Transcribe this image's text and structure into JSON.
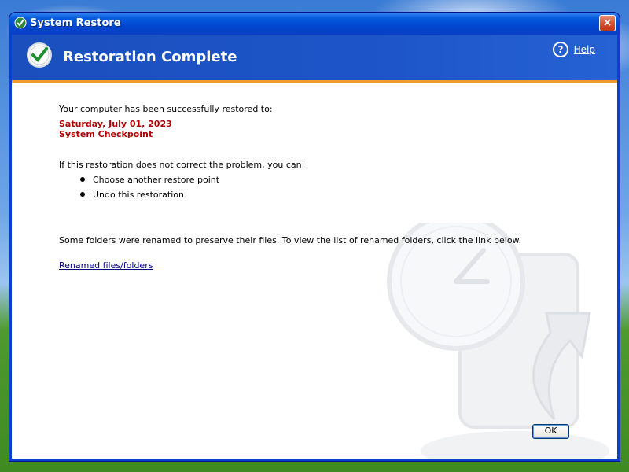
{
  "window": {
    "title": "System Restore",
    "close_label": "×"
  },
  "header": {
    "title": "Restoration Complete",
    "help_mark": "?",
    "help_label": "Help"
  },
  "content": {
    "restored_to_text": "Your computer has been successfully restored to:",
    "restore_date": "Saturday, July 01, 2023",
    "restore_point_name": "System Checkpoint",
    "options_intro": "If this restoration does not correct the problem, you can:",
    "options": [
      "Choose another restore point",
      "Undo this restoration"
    ],
    "renamed_note": "Some folders were renamed to preserve their files. To view the list of renamed folders, click the link below.",
    "renamed_link": "Renamed files/folders"
  },
  "buttons": {
    "ok_label": "OK"
  },
  "colors": {
    "header_blue": "#1d55c8",
    "accent_orange": "#ee9a2f",
    "date_red": "#b00000",
    "link_blue": "#000080"
  }
}
